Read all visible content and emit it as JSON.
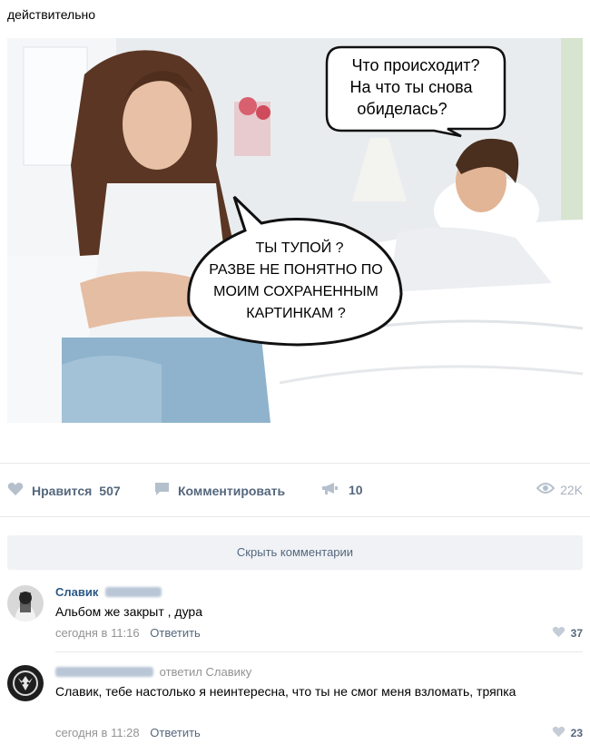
{
  "post": {
    "text": "действительно",
    "image": {
      "bubble_top": [
        "Что происходит?",
        "На что ты снова",
        "обиделась?"
      ],
      "bubble_center": [
        "ТЫ ТУПОЙ  ?",
        "РАЗВЕ НЕ ПОНЯТНО ПО",
        "МОИМ СОХРАНЕННЫМ",
        "КАРТИНКАМ ?"
      ]
    }
  },
  "actions": {
    "like_label": "Нравится",
    "like_count": "507",
    "comment_label": "Комментировать",
    "share_count": "10",
    "views_count": "22K",
    "icons": {
      "like": "heart-icon",
      "comment": "comment-icon",
      "share": "megaphone-icon",
      "views": "eye-icon"
    }
  },
  "hide_comments_label": "Скрыть комментарии",
  "comments": [
    {
      "author_first": "Славик",
      "text": "Альбом же закрыт , дура",
      "time": "сегодня в 11:16",
      "reply_label": "Ответить",
      "likes": "37"
    },
    {
      "replied_to": "ответил Славику",
      "text": "Славик, тебе настолько я неинтересна, что ты не смог меня взломать, тряпка",
      "time": "сегодня в 11:28",
      "reply_label": "Ответить",
      "likes": "23"
    }
  ],
  "colors": {
    "link": "#2a5885",
    "action": "#55677d",
    "muted": "#939393",
    "divider": "#e7e8ec",
    "button_bg": "#f0f2f5"
  }
}
